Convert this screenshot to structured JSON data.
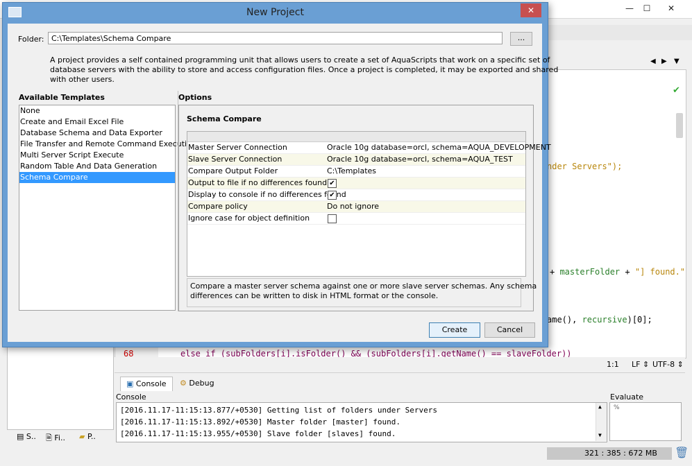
{
  "dialog": {
    "title": "New Project",
    "close_glyph": "✕",
    "folder_label": "Folder:",
    "folder_value": "C:\\Templates\\Schema Compare",
    "browse_label": "...",
    "description_lines": [
      "A project provides a self contained programming unit that allows users to create a set of AquaScripts that work on a specific set of",
      "database servers with the ability to store and access configuration files.  Once a project is completed, it may be exported and shared",
      "with other users."
    ],
    "templates_header": "Available Templates",
    "templates": [
      "None",
      "Create and Email Excel File",
      "Database Schema and Data Exporter",
      "File Transfer and Remote Command Execution",
      "Multi Server Script Execute",
      "Random Table And Data Generation",
      "Schema Compare"
    ],
    "selected_template_index": 6,
    "options_header": "Options",
    "options_title": "Schema Compare",
    "properties": [
      {
        "name": "Master Server Connection",
        "value": "Oracle 10g database=orcl, schema=AQUA_DEVELOPMENT"
      },
      {
        "name": "Slave Server Connection",
        "value": "Oracle 10g database=orcl, schema=AQUA_TEST"
      },
      {
        "name": "Compare Output Folder",
        "value": "C:\\Templates"
      },
      {
        "name": "Output to file if no differences found",
        "checked": true
      },
      {
        "name": "Display to console if no differences found",
        "checked": true
      },
      {
        "name": "Compare policy",
        "value": "Do not ignore"
      },
      {
        "name": "Ignore case for object definition",
        "checked": false
      }
    ],
    "option_description_lines": [
      "Compare a master server schema against one or more slave server schemas. Any schema",
      "differences can be written to disk in HTML format or the console."
    ],
    "create_label": "Create",
    "cancel_label": "Cancel"
  },
  "ide": {
    "window_buttons": [
      "—",
      "☐",
      "✕"
    ],
    "code_fragments": {
      "line1": "nder Servers\");",
      "line2a": "+ ",
      "line2b": "masterFolder",
      "line2c": " + ",
      "line2d": "\"] found.\");",
      "line3a": "ame(), ",
      "line3b": "recursive",
      "line3c": ")[0];",
      "line68_num": "68",
      "line68": "else if (subFolders[i].isFolder() && (subFolders[i].getName() == slaveFolder))"
    },
    "status": {
      "position": "1:1",
      "line_ending": "LF",
      "encoding": "UTF-8"
    },
    "tabs": [
      "Console",
      "Debug"
    ],
    "console_label": "Console",
    "evaluate_label": "Evaluate",
    "evaluate_value": "%",
    "console_lines": [
      "[2016.11.17-11:15:13.877/+0530] Getting list of folders under Servers",
      "[2016.11.17-11:15:13.892/+0530] Master folder [master] found.",
      "[2016.11.17-11:15:13.955/+0530] Slave folder [slaves] found."
    ],
    "left_tabs": [
      "S..",
      "Fi..",
      "P.."
    ],
    "memory": "321 : 385 : 672 MB"
  },
  "colors": {
    "selection": "#3399ff",
    "titlebar": "#6a9fd4",
    "close_button": "#c75050"
  }
}
